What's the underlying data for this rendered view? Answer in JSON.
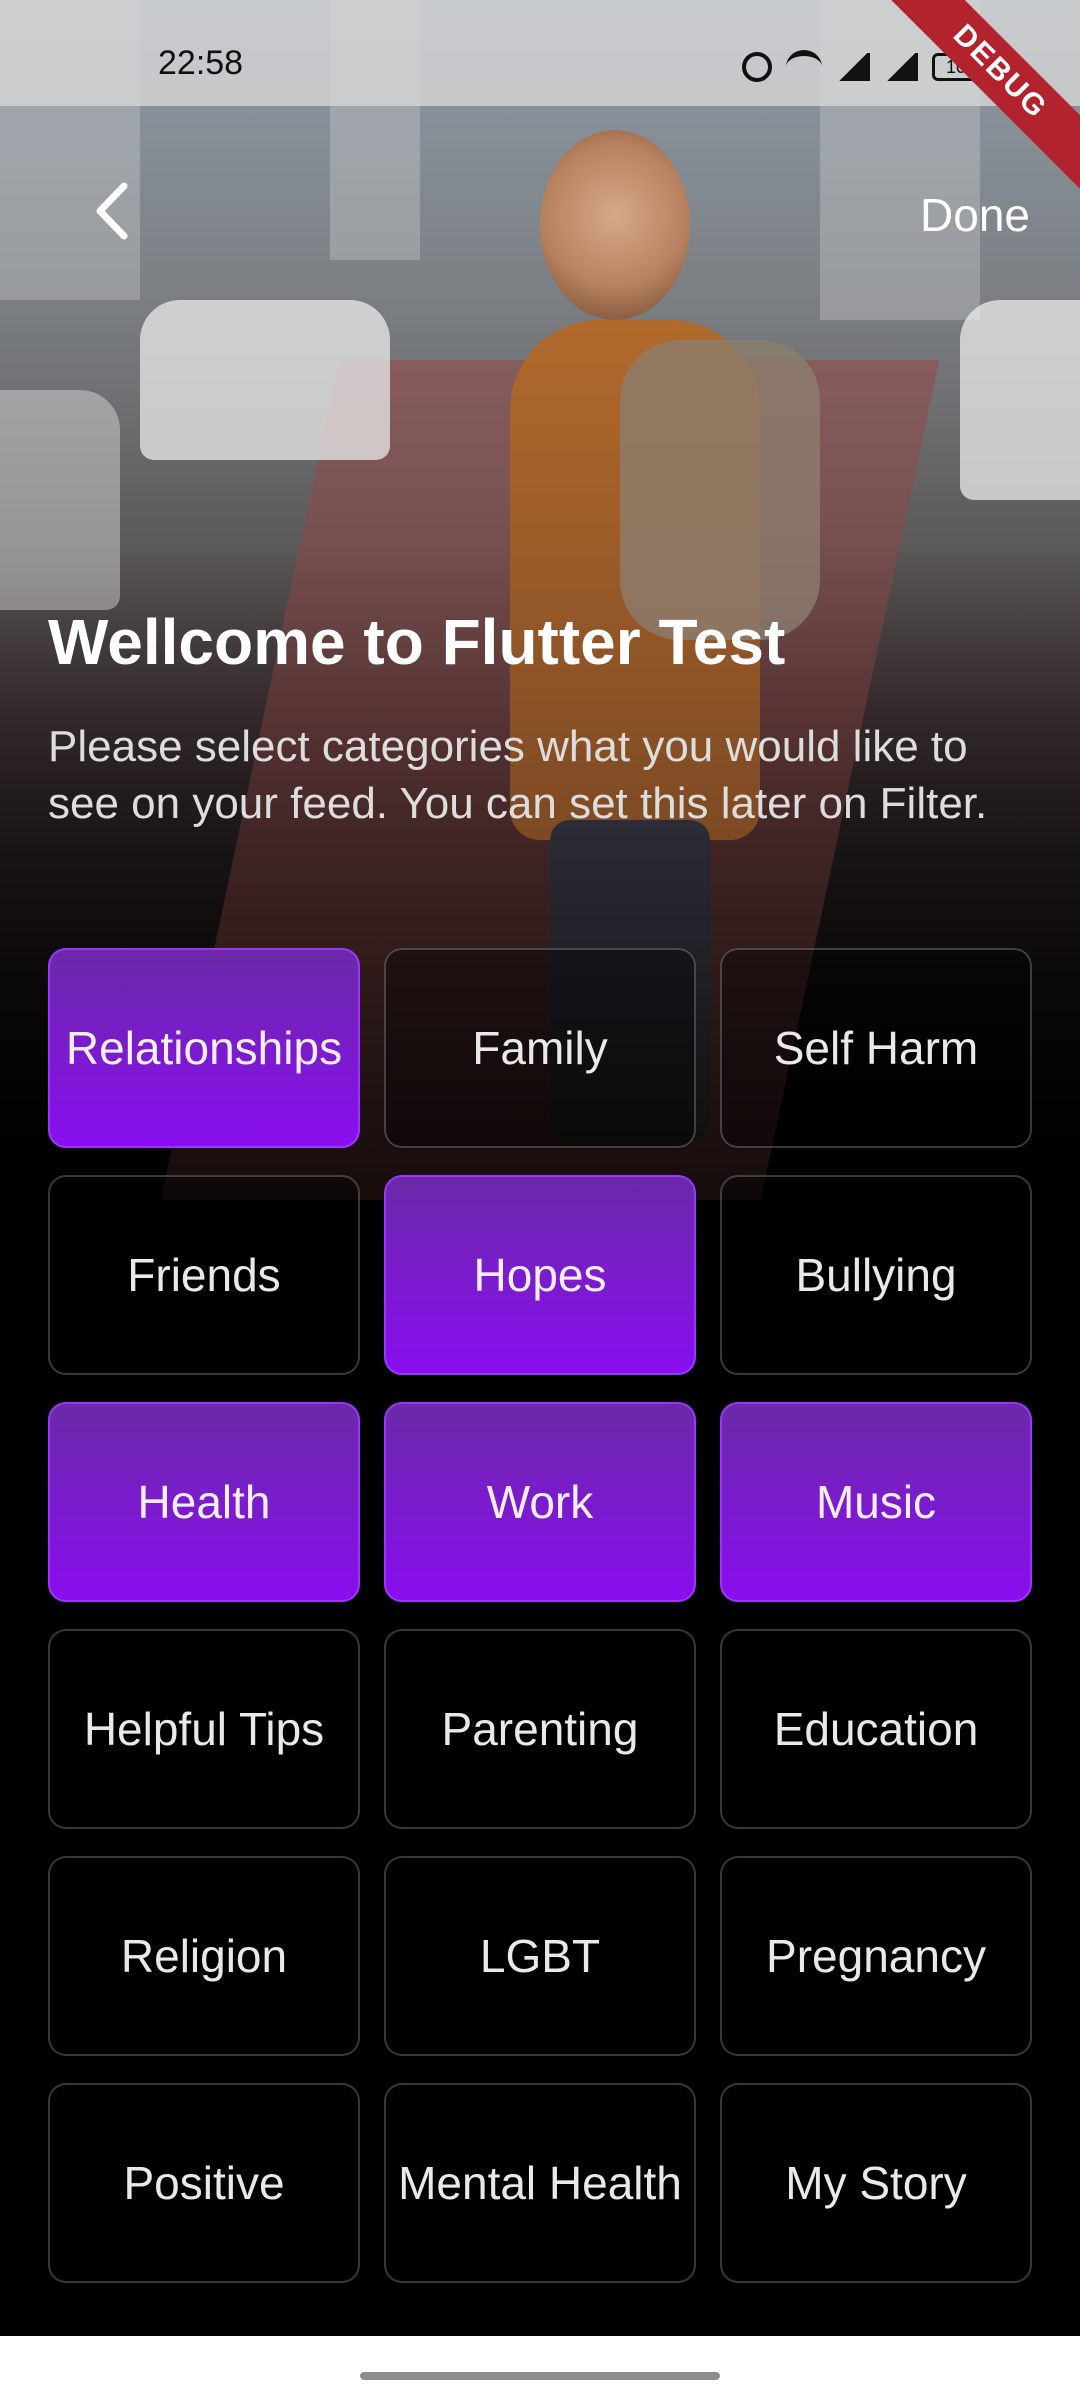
{
  "status_bar": {
    "time": "22:58",
    "battery": "100",
    "icons": [
      "alarm-icon",
      "wifi-icon",
      "signal-icon",
      "signal-icon",
      "battery-icon"
    ]
  },
  "debug_banner": "DEBUG",
  "nav": {
    "back_icon": "chevron-left-icon",
    "done_label": "Done"
  },
  "intro": {
    "title": "Wellcome to Flutter Test",
    "subtitle": "Please select categories what you would like to see on your feed. You can set this later on Filter."
  },
  "colors": {
    "selected_top": "#6a2aa8",
    "selected_bottom": "#8a0ef0",
    "tile_border": "#3a3a3a"
  },
  "categories": [
    {
      "label": "Relationships",
      "selected": true
    },
    {
      "label": "Family",
      "selected": false
    },
    {
      "label": "Self Harm",
      "selected": false
    },
    {
      "label": "Friends",
      "selected": false
    },
    {
      "label": "Hopes",
      "selected": true
    },
    {
      "label": "Bullying",
      "selected": false
    },
    {
      "label": "Health",
      "selected": true
    },
    {
      "label": "Work",
      "selected": true
    },
    {
      "label": "Music",
      "selected": true
    },
    {
      "label": "Helpful Tips",
      "selected": false
    },
    {
      "label": "Parenting",
      "selected": false
    },
    {
      "label": "Education",
      "selected": false
    },
    {
      "label": "Religion",
      "selected": false
    },
    {
      "label": "LGBT",
      "selected": false
    },
    {
      "label": "Pregnancy",
      "selected": false
    },
    {
      "label": "Positive",
      "selected": false
    },
    {
      "label": "Mental Health",
      "selected": false
    },
    {
      "label": "My Story",
      "selected": false
    }
  ]
}
